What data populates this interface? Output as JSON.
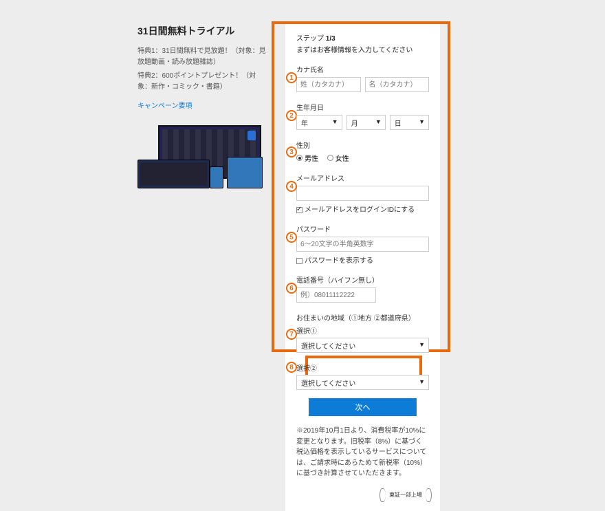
{
  "left": {
    "title": "31日間無料トライアル",
    "benefit1": "特典1：31日間無料で見放題！（対象：見放題動画・読み放題雑誌）",
    "benefit2": "特典2：600ポイントプレゼント！（対象：新作・コミック・書籍）",
    "campaign_link": "キャンペーン要項"
  },
  "form": {
    "step_prefix": "ステップ ",
    "step_num": "1/3",
    "step_desc": "まずはお客様情報を入力してください",
    "kana_label": "カナ氏名",
    "kana_last_ph": "姓（カタカナ）",
    "kana_first_ph": "名（カタカナ）",
    "dob_label": "生年月日",
    "year_ph": "年",
    "month_ph": "月",
    "day_ph": "日",
    "gender_label": "性別",
    "male": "男性",
    "female": "女性",
    "email_label": "メールアドレス",
    "email_login_check": "メールアドレスをログインIDにする",
    "pw_label": "パスワード",
    "pw_ph": "6～20文字の半角英数字",
    "pw_show": "パスワードを表示する",
    "tel_label": "電話番号（ハイフン無し）",
    "tel_ph": "例）08011112222",
    "region_label": "お住まいの地域（①地方 ②都道府県）",
    "select1_label": "選択①",
    "select2_label": "選択②",
    "select_ph": "選択してください",
    "next": "次へ"
  },
  "note": "※2019年10月1日より、消費税率が10%に変更となります。旧税率（8%）に基づく税込価格を表示しているサービスについては、ご請求時にあらためて新税率（10%）に基づき計算させていただきます。",
  "laurel": "東証一部上場"
}
